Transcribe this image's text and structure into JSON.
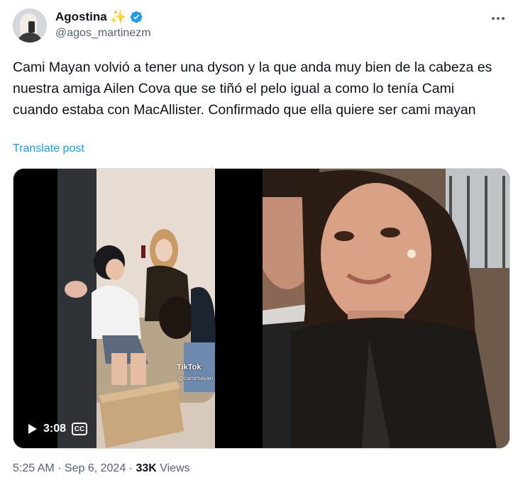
{
  "author": {
    "name": "Agostina",
    "emoji": "✨",
    "handle": "@agos_martinezm"
  },
  "icons": {
    "verified": "verified-badge-icon",
    "more": "more-options-icon",
    "play": "play-icon",
    "captions": "closed-captions-icon",
    "tiktok": "tiktok-logo-icon"
  },
  "post": {
    "text": "Cami Mayan volvió a tener una dyson y la que anda muy bien de la cabeza es nuestra amiga Ailen Cova que se tiñó el pelo igual a como lo tenía Cami cuando estaba con MacAllister. Confirmado que ella quiere ser cami mayan",
    "translate_label": "Translate post"
  },
  "media": {
    "video": {
      "duration": "3:08",
      "cc_label": "CC",
      "watermark": "TikTok",
      "watermark_handle": "@camimayan"
    }
  },
  "meta": {
    "time": "5:25 AM",
    "separator": " · ",
    "date": "Sep 6, 2024",
    "views_count": "33K",
    "views_label": " Views"
  },
  "colors": {
    "accent": "#1d9bf0",
    "secondary_text": "#536471",
    "primary_text": "#0f1419"
  }
}
